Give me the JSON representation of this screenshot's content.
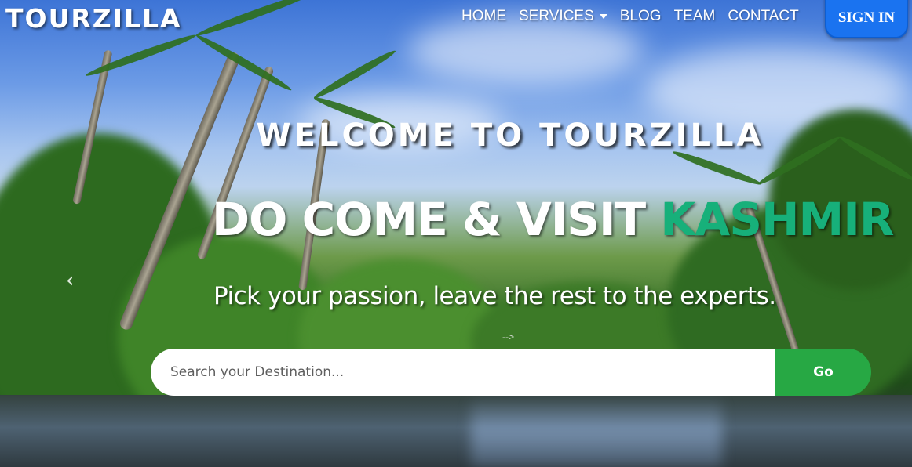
{
  "brand": {
    "name": "TOURZILLA"
  },
  "nav": {
    "items": [
      {
        "label": "HOME"
      },
      {
        "label": "SERVICES",
        "has_dropdown": true
      },
      {
        "label": "BLOG"
      },
      {
        "label": "TEAM"
      },
      {
        "label": "CONTACT"
      }
    ],
    "signin_label": "SIGN IN"
  },
  "hero": {
    "welcome": "WELCOME TO TOURZILLA",
    "headline_prefix": "DO COME & VISIT ",
    "headline_accent": "KASHMIR",
    "tagline": "Pick your passion, leave the rest to the experts.",
    "stray_text": "-->",
    "prev_icon": "chevron-left-icon"
  },
  "search": {
    "placeholder": "Search your Destination...",
    "button_label": "Go"
  },
  "colors": {
    "accent_green": "#17b07a",
    "button_green": "#27a844",
    "signin_blue": "#1a73f0"
  }
}
